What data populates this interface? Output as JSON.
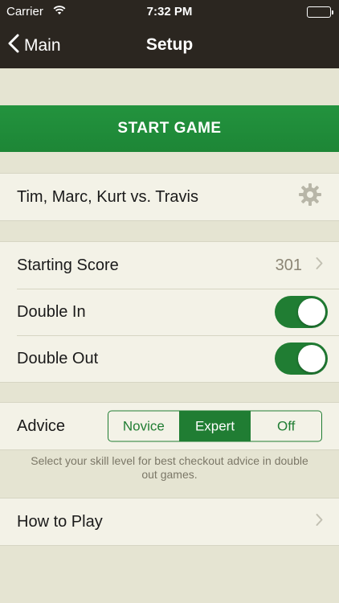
{
  "status_bar": {
    "carrier": "Carrier",
    "time": "7:32 PM"
  },
  "nav": {
    "back_label": "Main",
    "title": "Setup"
  },
  "start_button": {
    "label": "START GAME"
  },
  "players": {
    "label": "Tim, Marc, Kurt vs. Travis"
  },
  "settings": {
    "starting_score": {
      "label": "Starting Score",
      "value": "301"
    },
    "double_in": {
      "label": "Double In",
      "on": true
    },
    "double_out": {
      "label": "Double Out",
      "on": true
    }
  },
  "advice": {
    "label": "Advice",
    "options": [
      "Novice",
      "Expert",
      "Off"
    ],
    "selected": "Expert",
    "note": "Select your skill level for best checkout advice in double out games."
  },
  "how_to_play": {
    "label": "How to Play"
  },
  "colors": {
    "nav_background": "#2b2620",
    "accent_green": "#207d33",
    "start_button_green": "#1f8a38",
    "page_background": "#e5e4d2",
    "cell_background": "#f3f2e7"
  }
}
